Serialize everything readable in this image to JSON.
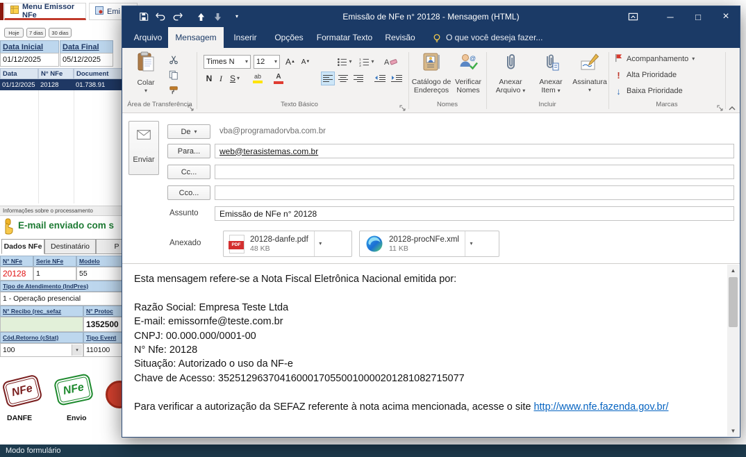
{
  "colors": {
    "titlebar_blue": "#1b3a66",
    "ribbon_bg": "#f3f2f1",
    "table_header_blue": "#bdd7ee",
    "table_header_text": "#1f3864",
    "nfe_number_red": "#e01010",
    "success_green": "#1e7b34",
    "link_blue": "#0563c1",
    "statusbar_dark": "#1d3a4d"
  },
  "app": {
    "tab_menu": "Menu Emissor NFe",
    "tab_emi": "Emi",
    "filter_hoje": "Hoje",
    "filter_7dias": "7 dias",
    "filter_30dias": "30 dias",
    "data_inicial_label": "Data Inicial",
    "data_inicial_value": "01/12/2025",
    "data_final_label": "Data Final",
    "data_final_value": "05/12/2025",
    "grid_col_data": "Data",
    "grid_col_nfe": "N° NFe",
    "grid_col_doc": "Document",
    "grid_row_data": "01/12/2025",
    "grid_row_nfe": "20128",
    "grid_row_doc": "01.738.91",
    "info_bar": "Informações sobre o processamento",
    "status_msg": "E-mail enviado com s",
    "tab_dados": "Dados NFe",
    "tab_destinatario": "Destinatário",
    "tab_p": "P",
    "h_nfe": "N° NFe",
    "h_serie": "Serie NFe",
    "h_modelo": "Modelo",
    "v_nfe": "20128",
    "v_serie": "1",
    "v_modelo": "55",
    "h_tipo": "Tipo de Atendimento (IndPres)",
    "v_tipo": "1 - Operação presencial",
    "h_recibo": "N° Recibo (rec_sefaz",
    "h_protocolo": "N° Protoc",
    "v_protocolo": "1352500",
    "h_cstat": "Cód.Retorno (cStat)",
    "h_evento": "Tipo Event",
    "v_cstat": "100",
    "v_evento": "110100",
    "stamp_text": "NFe",
    "stamp_danfe": "DANFE",
    "stamp_envio": "Envio",
    "statusbar": "Modo formulário"
  },
  "outlook": {
    "title": "Emissão de NFe n° 20128 - Mensagem (HTML)",
    "tab_arquivo": "Arquivo",
    "tab_mensagem": "Mensagem",
    "tab_inserir": "Inserir",
    "tab_opcoes": "Opções",
    "tab_formatar": "Formatar Texto",
    "tab_revisao": "Revisão",
    "tellme": "O que você deseja fazer...",
    "ribbon": {
      "colar": "Colar",
      "g_transferencia": "Área de Transferência",
      "font_name": "Times N",
      "font_size": "12",
      "bold": "N",
      "italic": "I",
      "underline": "S",
      "g_texto": "Texto Básico",
      "catalogo_l1": "Catálogo de",
      "catalogo_l2": "Endereços",
      "verificar_l1": "Verificar",
      "verificar_l2": "Nomes",
      "g_nomes": "Nomes",
      "anexar1_l1": "Anexar",
      "anexar1_l2": "Arquivo",
      "anexar2_l1": "Anexar",
      "anexar2_l2": "Item",
      "assinatura": "Assinatura",
      "g_incluir": "Incluir",
      "acompanhamento": "Acompanhamento",
      "alta_prioridade": "Alta Prioridade",
      "baixa_prioridade": "Baixa Prioridade",
      "g_marcas": "Marcas"
    },
    "compose": {
      "enviar": "Enviar",
      "de_label": "De",
      "de_value": "vba@programadorvba.com.br",
      "para_label": "Para...",
      "para_value": "web@terasistemas.com.br",
      "cc_label": "Cc...",
      "cco_label": "Cco...",
      "assunto_label": "Assunto",
      "assunto_value": "Emissão de NFe n° 20128",
      "anexado_label": "Anexado",
      "att1_name": "20128-danfe.pdf",
      "att1_size": "48 KB",
      "att1_badge": "PDF",
      "att2_name": "20128-procNFe.xml",
      "att2_size": "11 KB"
    },
    "body": {
      "intro": "Esta mensagem refere-se a Nota Fiscal Eletrônica Nacional emitida por:",
      "line1": "Razão Social: Empresa Teste Ltda",
      "line2": "E-mail: emissornfe@teste.com.br",
      "line3": "CNPJ: 00.000.000/0001-00",
      "line4": "N° Nfe:  20128",
      "line5": "Situação: Autorizado o uso da NF-e",
      "line6": "Chave de Acesso: 35251296370416000170550010000201281082715077",
      "footer_prefix": "Para verificar a autorização da SEFAZ referente à nota acima mencionada, acesse o site ",
      "footer_link": "http://www.nfe.fazenda.gov.br/"
    }
  }
}
